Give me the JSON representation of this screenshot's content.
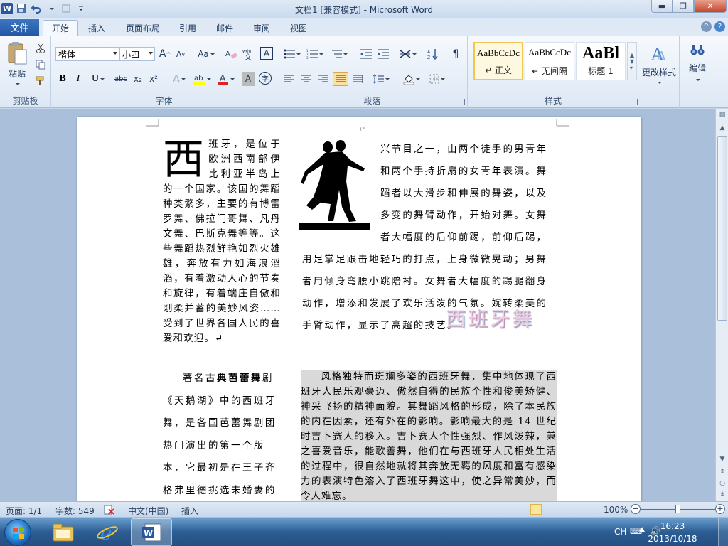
{
  "window": {
    "title": "文档1 [兼容模式] - Microsoft Word",
    "minimize": "▬",
    "maximize": "❐",
    "close": "✕"
  },
  "tabs": {
    "file": "文件",
    "items": [
      "开始",
      "插入",
      "页面布局",
      "引用",
      "邮件",
      "审阅",
      "视图"
    ],
    "active_index": 0
  },
  "ribbon": {
    "clipboard": {
      "label": "剪贴板",
      "paste": "粘贴"
    },
    "font": {
      "label": "字体",
      "font_name": "楷体",
      "font_size": "小四",
      "grow": "A",
      "shrink": "A",
      "case": "Aa",
      "bold": "B",
      "italic": "I",
      "underline": "U",
      "strike": "abc",
      "sub": "x₂",
      "sup": "x²",
      "text_effect": "A",
      "font_color": "A",
      "char_shade": "A",
      "enclose": "字",
      "phonetic": "wén",
      "border": "A",
      "clear": "A"
    },
    "paragraph": {
      "label": "段落"
    },
    "styles": {
      "label": "样式",
      "tiles": [
        {
          "preview": "AaBbCcDc",
          "name": "↵ 正文"
        },
        {
          "preview": "AaBbCcDc",
          "name": "↵ 无间隔"
        },
        {
          "preview": "AaBl",
          "name": "标题 1"
        }
      ],
      "change_styles": "更改样式"
    },
    "editing": {
      "label": "编辑"
    }
  },
  "document": {
    "col1a_dropcap": "西",
    "col1a_text": "班牙，是位于欧洲西南部伊比利亚半岛上的一个国家。该国的舞蹈种类繁多，主要的有博雷罗舞、佛拉门哥舞、凡丹文舞、巴斯克舞等等。这些舞蹈热烈鲜艳如烈火雄雄，奔放有力如海浪滔滔，有着激动人心的节奏和旋律，有着端庄自傲和刚柔并蓄的美妙风姿……受到了世界各国人民的喜爱和欢迎。↵",
    "col1b_lead": "著名",
    "col1b_bold": "古典芭蕾舞",
    "col1b_text": "剧《天鹅湖》中的西班牙舞，是各国芭蕾舞剧团热门演出的第一个版本，它最初是在王子齐格弗里德挑选未婚妻的",
    "col2a_text": "兴节目之一，由两个徒手的男青年和两个手持折扇的女青年表演。舞蹈者以大滑步和伸展的舞姿，以及多变的舞臂动作，开始对舞。女舞者大幅度的后仰前踢，前仰后踢，用足掌足跟击地轻巧的打点，上身微微晃动；男舞者用倾身弯腰小跳陪衬。女舞者大幅度的踢腿翻身动作，增添和发展了欢乐活泼的气氛。婉转柔美的手臂动作，显示了高超的技艺。↵",
    "wordart": "西班牙舞",
    "col2b_text": "风格独特而斑斓多姿的西班牙舞，集中地体现了西班牙人民乐观豪迈、傲然自得的民族个性和俊美矫健、神采飞扬的精神面貌。其舞蹈风格的形成，除了本民族的内在因素，还有外在的影响。影响最大的是 14 世纪时吉卜赛人的移入。吉卜赛人个性强烈、作风泼辣，兼之喜爱音乐，能歌善舞，他们在与西班牙人民相处生活的过程中，很自然地就将其奔放无羁的风度和富有感染力的表演特色溶入了西班牙舞这中，使之异常美妙，而令人难忘。",
    "para_mark": "↵",
    "picture_label": "dancing-couple-silhouette"
  },
  "status": {
    "page": "页面: 1/1",
    "words": "字数: 549",
    "language": "中文(中国)",
    "mode": "插入",
    "zoom": "100%",
    "zoom_level": 100
  },
  "taskbar": {
    "apps": [
      "explorer",
      "internet-explorer",
      "word"
    ],
    "active_app": "word",
    "ime": "CH",
    "time": "16:23",
    "date": "2013/10/18"
  }
}
